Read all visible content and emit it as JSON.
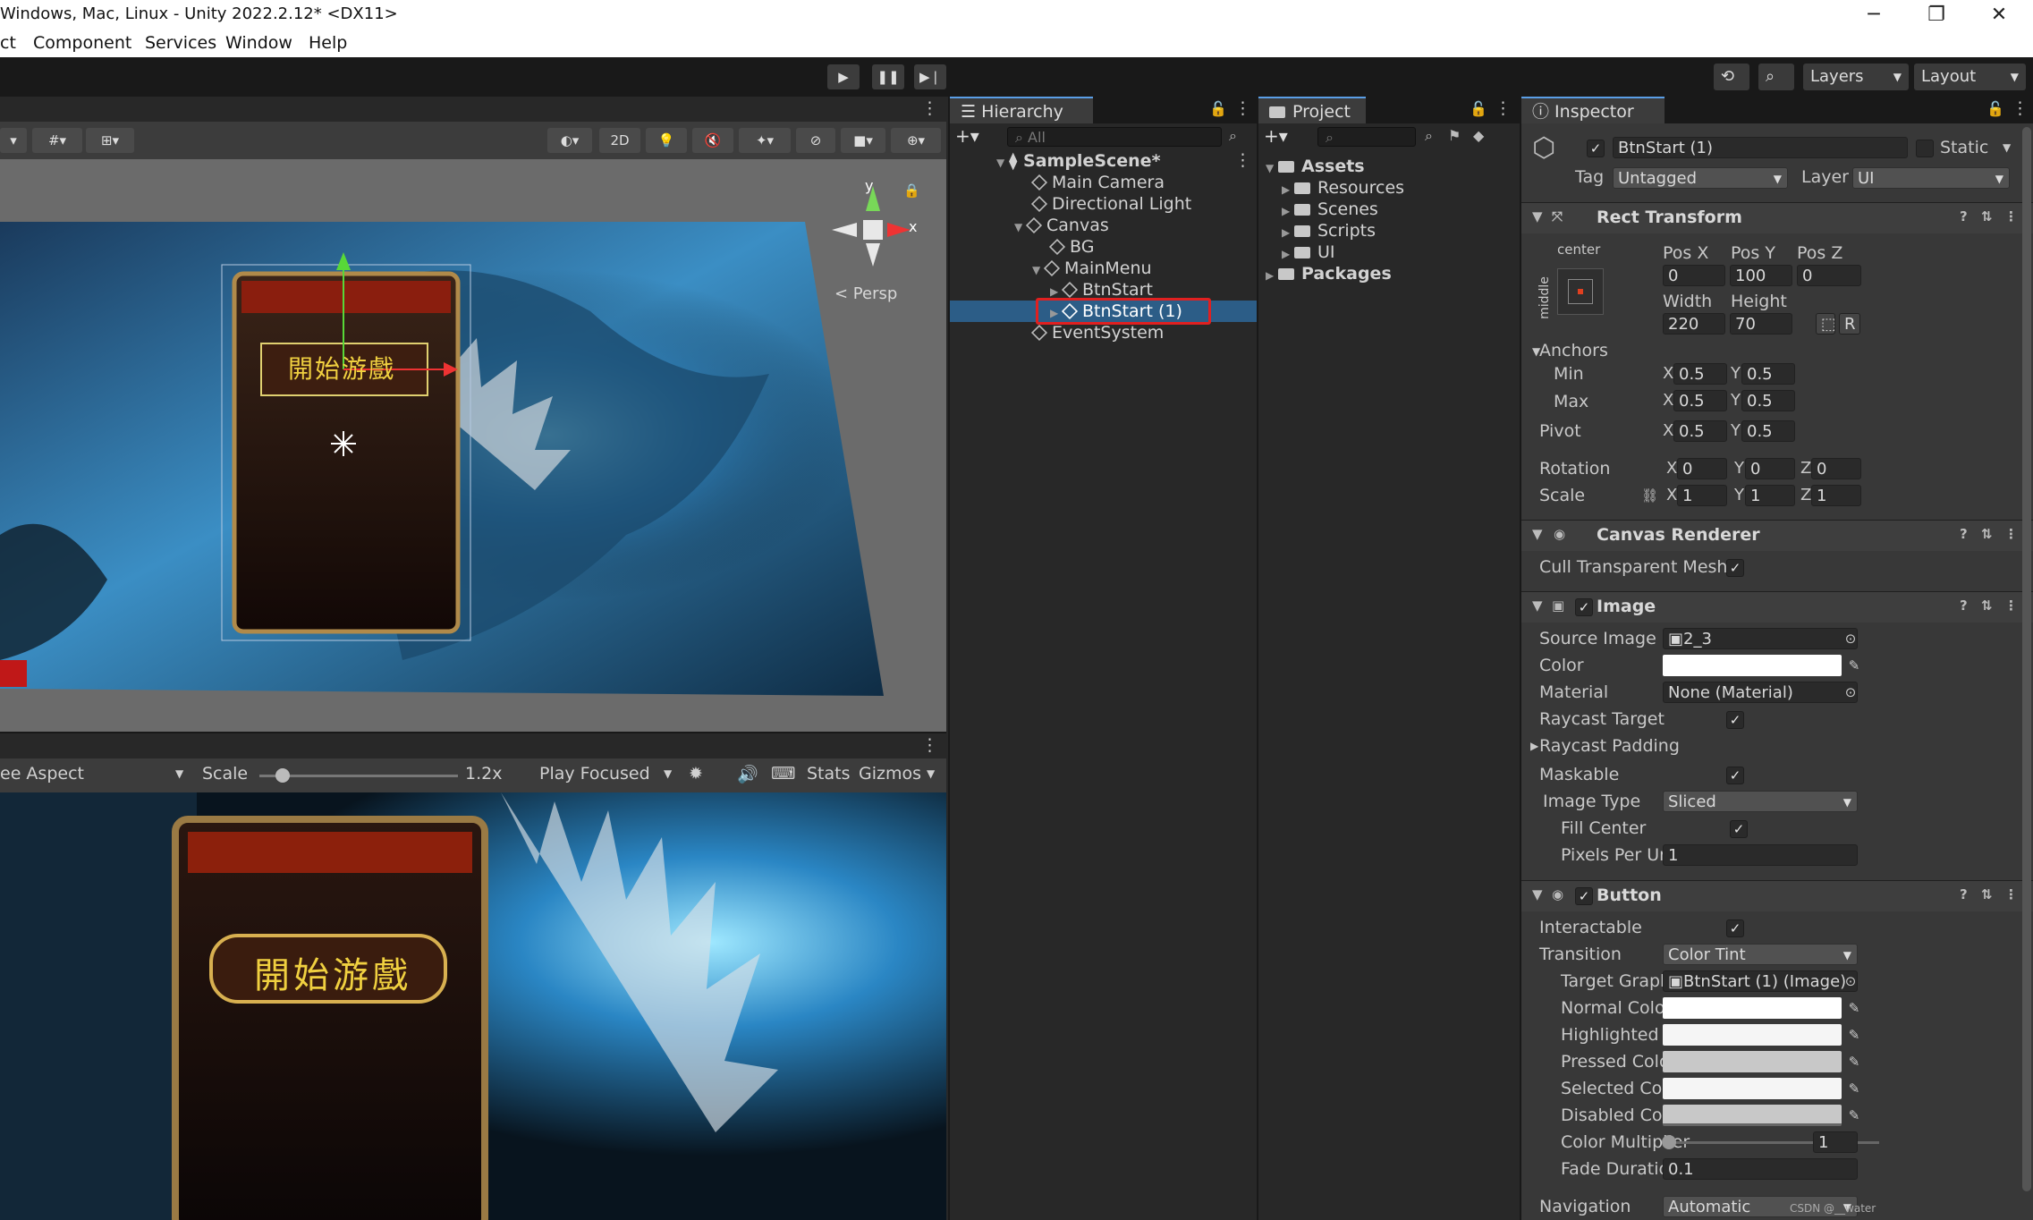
{
  "window": {
    "title": "Windows, Mac, Linux - Unity 2022.2.12* <DX11>"
  },
  "menu": [
    "ct",
    "Component",
    "Services",
    "Window",
    "Help"
  ],
  "toolbar": {
    "layers": "Layers",
    "layout": "Layout"
  },
  "scene": {
    "btn_2d": "2D",
    "persp": "< Persp",
    "axis_y": "y",
    "axis_x": "x",
    "button_text": "開始游戲"
  },
  "game": {
    "aspect": "ee Aspect",
    "scale_label": "Scale",
    "scale_value": "1.2x",
    "play_focused": "Play Focused",
    "stats": "Stats",
    "gizmos": "Gizmos",
    "button_text": "開始游戲"
  },
  "hierarchy": {
    "tab": "Hierarchy",
    "search_placeholder": "All",
    "items": [
      {
        "label": "SampleScene*"
      },
      {
        "label": "Main Camera"
      },
      {
        "label": "Directional Light"
      },
      {
        "label": "Canvas"
      },
      {
        "label": "BG"
      },
      {
        "label": "MainMenu"
      },
      {
        "label": "BtnStart"
      },
      {
        "label": "BtnStart (1)"
      },
      {
        "label": "EventSystem"
      }
    ]
  },
  "project": {
    "tab": "Project",
    "items": [
      {
        "label": "Assets"
      },
      {
        "label": "Resources"
      },
      {
        "label": "Scenes"
      },
      {
        "label": "Scripts"
      },
      {
        "label": "UI"
      },
      {
        "label": "Packages"
      }
    ]
  },
  "inspector": {
    "tab": "Inspector",
    "object_name": "BtnStart (1)",
    "static_label": "Static",
    "tag_label": "Tag",
    "tag_value": "Untagged",
    "layer_label": "Layer",
    "layer_value": "UI",
    "rect": {
      "title": "Rect Transform",
      "center": "center",
      "middle": "middle",
      "posx_label": "Pos X",
      "posx": "0",
      "posy_label": "Pos Y",
      "posy": "100",
      "posz_label": "Pos Z",
      "posz": "0",
      "width_label": "Width",
      "width": "220",
      "height_label": "Height",
      "height": "70",
      "r_btn": "R",
      "anchors": "Anchors",
      "min": "Min",
      "min_x": "0.5",
      "min_y": "0.5",
      "max": "Max",
      "max_x": "0.5",
      "max_y": "0.5",
      "pivot": "Pivot",
      "pivot_x": "0.5",
      "pivot_y": "0.5",
      "rotation": "Rotation",
      "rot_x": "0",
      "rot_y": "0",
      "rot_z": "0",
      "scale": "Scale",
      "scale_x": "1",
      "scale_y": "1",
      "scale_z": "1",
      "x": "X",
      "y": "Y",
      "z": "Z"
    },
    "canvas_renderer": {
      "title": "Canvas Renderer",
      "cull": "Cull Transparent Mesh"
    },
    "image": {
      "title": "Image",
      "source_label": "Source Image",
      "source": "2_3",
      "color_label": "Color",
      "material_label": "Material",
      "material": "None (Material)",
      "raycast_target": "Raycast Target",
      "raycast_padding": "Raycast Padding",
      "maskable": "Maskable",
      "image_type_label": "Image Type",
      "image_type": "Sliced",
      "fill_center": "Fill Center",
      "ppu_label": "Pixels Per Unit Multi",
      "ppu": "1"
    },
    "button": {
      "title": "Button",
      "interactable": "Interactable",
      "transition_label": "Transition",
      "transition": "Color Tint",
      "target_graphic_label": "Target Graphic",
      "target_graphic": "BtnStart (1) (Image)",
      "normal": "Normal Color",
      "highlighted": "Highlighted Color",
      "pressed": "Pressed Color",
      "selected": "Selected Color",
      "disabled": "Disabled Color",
      "multiplier_label": "Color Multiplier",
      "multiplier": "1",
      "fade_label": "Fade Duration",
      "fade": "0.1",
      "navigation_label": "Navigation",
      "navigation": "Automatic"
    },
    "watermark": "CSDN @__water"
  },
  "colors": {
    "selection": "#2c5d87",
    "highlight_box": "#e02020",
    "white_swatch": "#ffffff",
    "pressed_swatch": "#c8c8c8",
    "disabled_swatch": "#c8c8c8"
  }
}
